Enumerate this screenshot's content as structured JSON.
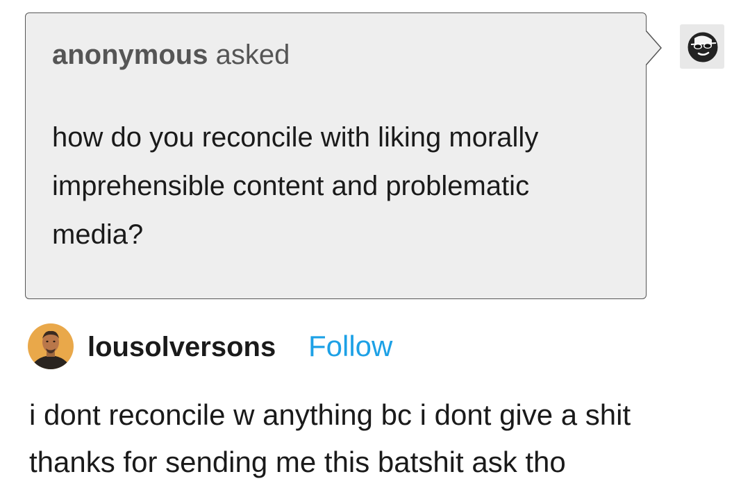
{
  "ask": {
    "asker": "anonymous",
    "verb": "asked",
    "question": "how do you reconcile with liking morally imprehensible content and problematic media?",
    "asker_avatar_icon": "sunglasses-face-icon"
  },
  "answer": {
    "blog_name": "lousolversons",
    "follow_label": "Follow",
    "avatar_icon": "user-portrait-avatar",
    "lines": [
      "i dont reconcile w anything bc i dont give a shit",
      "thanks for sending me this batshit ask tho"
    ]
  },
  "colors": {
    "bubble_bg": "#eeeeee",
    "bubble_border": "#555555",
    "follow_blue": "#1da1e6",
    "text": "#1a1a1a"
  }
}
